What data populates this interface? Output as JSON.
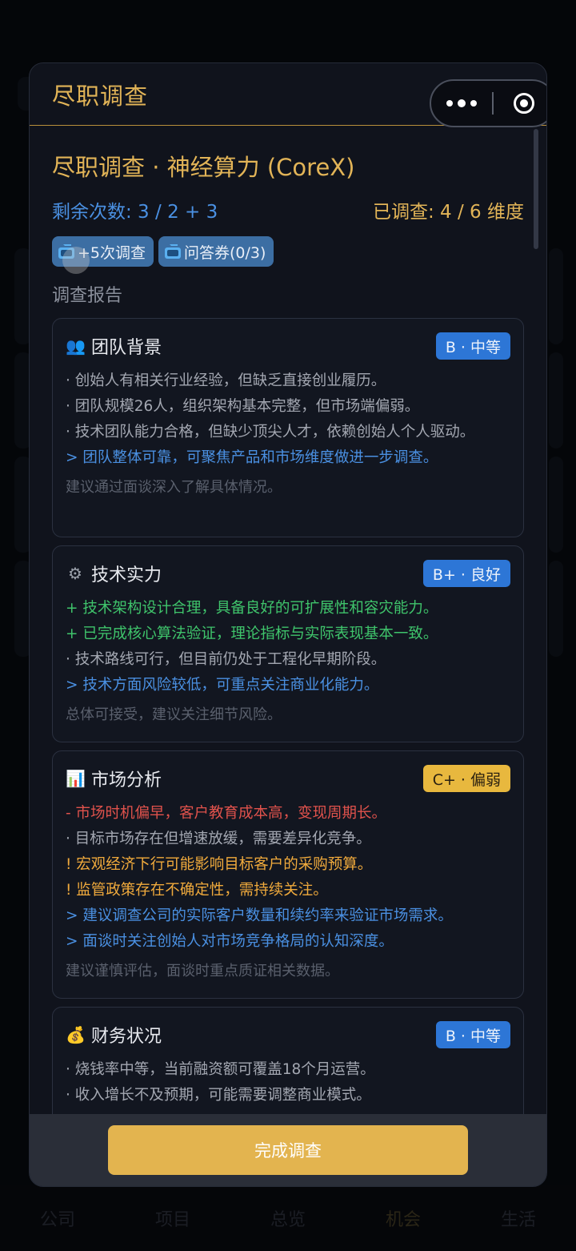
{
  "background_app": {
    "tabs": [
      {
        "label": "公司"
      },
      {
        "label": "项目"
      },
      {
        "label": "总览"
      },
      {
        "label": "机会"
      },
      {
        "label": "生活"
      }
    ]
  },
  "modal": {
    "title": "尽职调查",
    "subtitle": "尽职调查 · 神经算力 (CoreX)",
    "remaining": "剩余次数: 3 / 2 + 3",
    "investigated": "已调查: 4 / 6 维度",
    "chips": [
      {
        "label": "+5次调查",
        "icon": "tv-icon"
      },
      {
        "label": "问答券(0/3)",
        "icon": "tv-icon"
      }
    ],
    "report_label": "调查报告",
    "cards": [
      {
        "icon": "👥",
        "title": "团队背景",
        "badge": "B · 中等",
        "lines": [
          "· 创始人有相关行业经验，但缺乏直接创业履历。",
          "· 团队规模26人，组织架构基本完整，但市场端偏弱。",
          "· 技术团队能力合格，但缺少顶尖人才，依赖创始人个人驱动。",
          "> 团队整体可靠，可聚焦产品和市场维度做进一步调查。"
        ],
        "note": "建议通过面谈深入了解具体情况。"
      },
      {
        "icon": "⚙",
        "title": "技术实力",
        "badge": "B+ · 良好",
        "lines": [
          "+ 技术架构设计合理，具备良好的可扩展性和容灾能力。",
          "+ 已完成核心算法验证，理论指标与实际表现基本一致。",
          "· 技术路线可行，但目前仍处于工程化早期阶段。",
          "> 技术方面风险较低，可重点关注商业化能力。"
        ],
        "note": "总体可接受，建议关注细节风险。"
      },
      {
        "icon": "📊",
        "title": "市场分析",
        "badge": "C+ · 偏弱",
        "lines": [
          "- 市场时机偏早，客户教育成本高，变现周期长。",
          "· 目标市场存在但增速放缓，需要差异化竞争。",
          "! 宏观经济下行可能影响目标客户的采购预算。",
          "! 监管政策存在不确定性，需持续关注。",
          "> 建议调查公司的实际客户数量和续约率来验证市场需求。",
          "> 面谈时关注创始人对市场竞争格局的认知深度。"
        ],
        "note": "建议谨慎评估，面谈时重点质证相关数据。"
      },
      {
        "icon": "💰",
        "title": "财务状况",
        "badge": "B · 中等",
        "lines": [
          "· 烧钱率中等，当前融资额可覆盖18个月运营。",
          "· 收入增长不及预期，可能需要调整商业模式。"
        ]
      }
    ],
    "done_button": "完成调查"
  },
  "colors": {
    "gold": "#e2b457",
    "blue": "#4a90e2",
    "green": "#3fc46b",
    "red": "#e0524c",
    "orange": "#f0aa3c"
  }
}
